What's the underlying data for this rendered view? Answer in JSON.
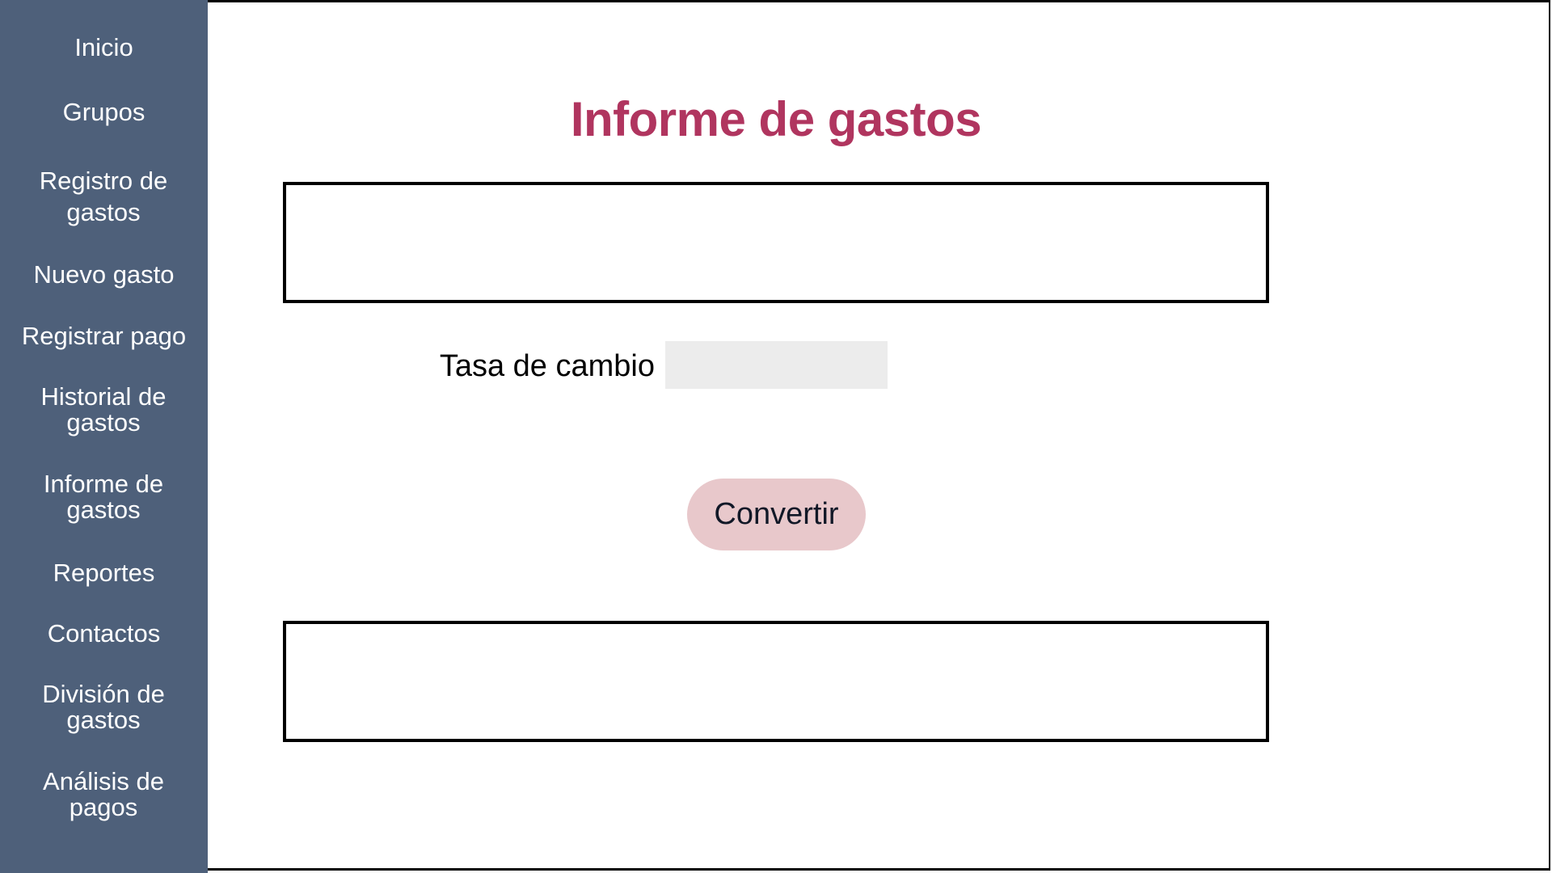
{
  "sidebar": {
    "items": [
      {
        "label": "Inicio"
      },
      {
        "label": "Grupos"
      },
      {
        "label": "Registro de gastos"
      },
      {
        "label": "Nuevo gasto"
      },
      {
        "label": "Registrar pago"
      },
      {
        "label": "Historial de gastos"
      },
      {
        "label": "Informe de gastos"
      },
      {
        "label": "Reportes"
      },
      {
        "label": "Contactos"
      },
      {
        "label": "División de gastos"
      },
      {
        "label": "Análisis de pagos"
      }
    ]
  },
  "main": {
    "title": "Informe de gastos",
    "rate_label": "Tasa de cambio",
    "rate_value": "",
    "convert_label": "Convertir"
  },
  "colors": {
    "sidebar": "#4e607a",
    "title": "#b0355f",
    "button": "#e8c8cb",
    "input": "#ececec"
  }
}
